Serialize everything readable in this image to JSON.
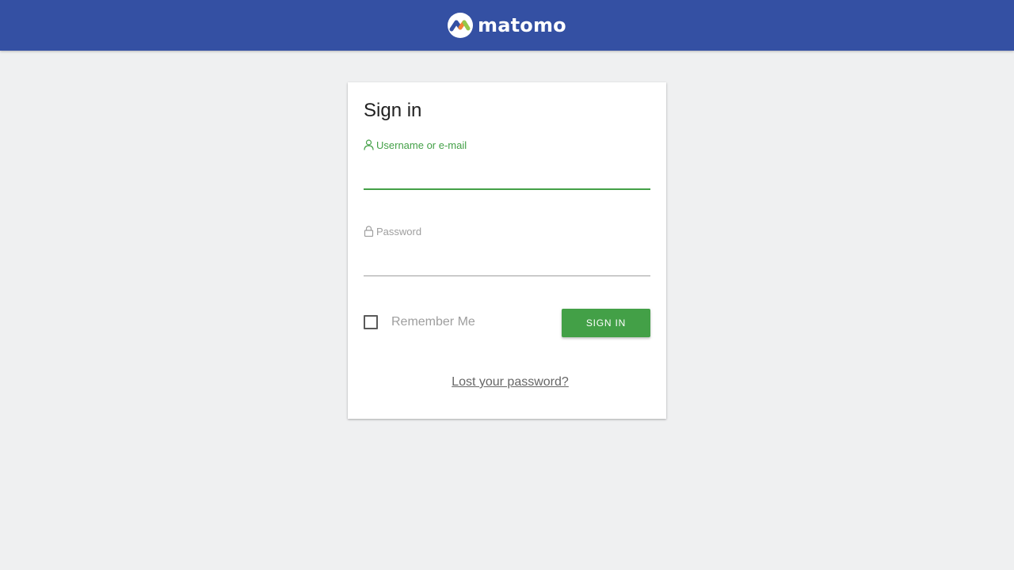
{
  "header": {
    "brand": "matomo",
    "background_color": "#3450a3"
  },
  "login": {
    "title": "Sign in",
    "username": {
      "label": "Username or e-mail",
      "value": "",
      "icon": "user-icon"
    },
    "password": {
      "label": "Password",
      "value": "",
      "icon": "lock-icon"
    },
    "remember_me": {
      "label": "Remember Me",
      "checked": false
    },
    "submit_label": "SIGN IN",
    "lost_password_link": "Lost your password?"
  },
  "colors": {
    "accent_green": "#43a047",
    "page_background": "#eff0f1",
    "muted_text": "#9e9e9e"
  }
}
